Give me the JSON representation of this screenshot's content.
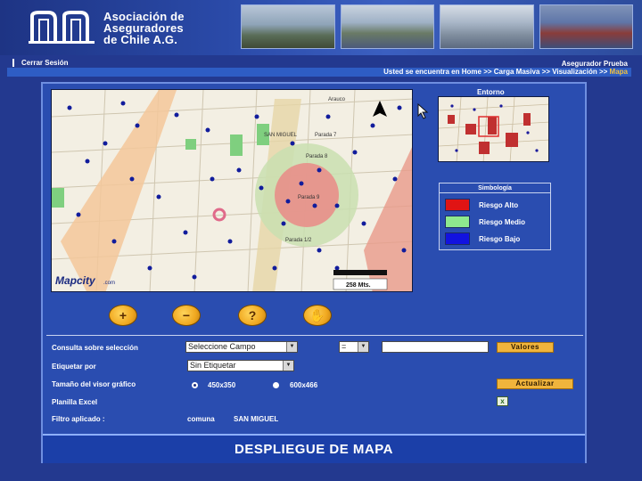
{
  "header": {
    "org_line1": "Asociación de",
    "org_line2": "Aseguradores",
    "org_line3": "de Chile A.G."
  },
  "nav": {
    "logout_label": "Cerrar Sesión",
    "user_label": "Asegurador Prueba",
    "breadcrumb_prefix": "Usted se encuentra en",
    "crumb_home": "Home",
    "crumb_sep": ">>",
    "crumb_carga": "Carga Masiva",
    "crumb_visual": "Visualización",
    "crumb_mapa": "Mapa"
  },
  "map": {
    "streets": [
      "Parada 7",
      "Parada 8",
      "Parada 9",
      "Parada 1/2",
      "SAN MIGUEL",
      "Arauco"
    ],
    "brand": "Mapcity",
    "brand_suffix": ".com",
    "scale_label": "258 Mts."
  },
  "overview": {
    "title": "Entorno"
  },
  "legend": {
    "title": "Simbología",
    "items": [
      {
        "label": "Riesgo Alto",
        "color": "#e01414"
      },
      {
        "label": "Riesgo Medio",
        "color": "#8ee88e"
      },
      {
        "label": "Riesgo Bajo",
        "color": "#1212e0"
      }
    ]
  },
  "tools": [
    {
      "icon": "zoom-in-icon",
      "glyph": "+"
    },
    {
      "icon": "zoom-out-icon",
      "glyph": "−"
    },
    {
      "icon": "help-icon",
      "glyph": "?"
    },
    {
      "icon": "pan-hand-icon",
      "glyph": "✋"
    }
  ],
  "form": {
    "query_label": "Consulta sobre selección",
    "field_select": "Seleccione Campo",
    "operator_select": "=",
    "values_button": "Valores",
    "tag_label": "Etiquetar por",
    "tag_select": "Sin Etiquetar",
    "size_label": "Tamaño del visor gráfico",
    "size_opt1": "450x350",
    "size_opt2": "600x466",
    "update_button": "Actualizar",
    "excel_label": "Planilla Excel",
    "filter_label": "Filtro aplicado :",
    "filter_field": "comuna",
    "filter_value": "SAN MIGUEL"
  },
  "footer": {
    "title": "DESPLIEGUE DE MAPA"
  }
}
